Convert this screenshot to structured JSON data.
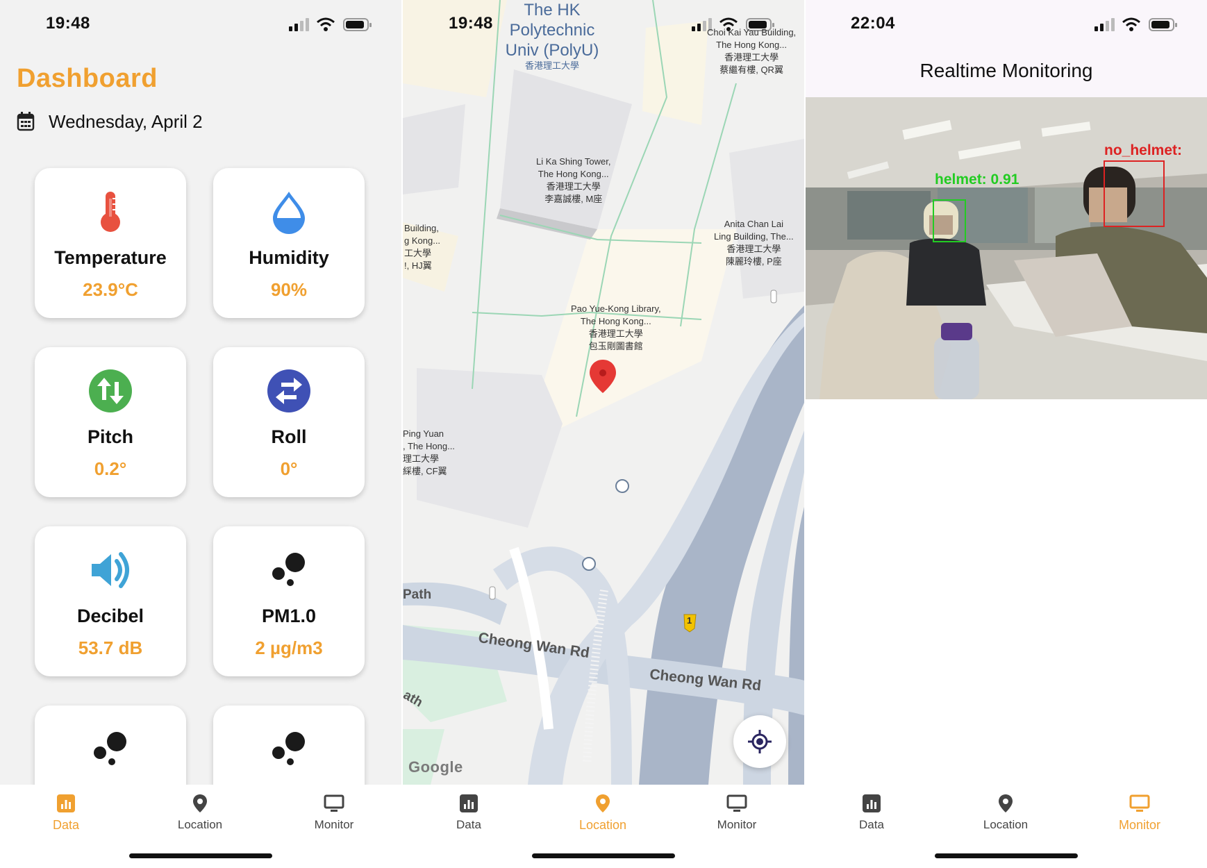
{
  "screens": {
    "data": {
      "time": "19:48",
      "title": "Dashboard",
      "date": "Wednesday, April 2",
      "cards": [
        {
          "label": "Temperature",
          "value": "23.9°C",
          "icon": "thermometer-icon"
        },
        {
          "label": "Humidity",
          "value": "90%",
          "icon": "water-drop-icon"
        },
        {
          "label": "Pitch",
          "value": "0.2°",
          "icon": "swap-vertical-icon"
        },
        {
          "label": "Roll",
          "value": "0°",
          "icon": "swap-horizontal-icon"
        },
        {
          "label": "Decibel",
          "value": "53.7 dB",
          "icon": "speaker-icon"
        },
        {
          "label": "PM1.0",
          "value": "2 µg/m3",
          "icon": "bubbles-icon"
        }
      ],
      "partial_card_icons": [
        "bubbles-icon",
        "bubbles-icon"
      ]
    },
    "location": {
      "time": "19:48",
      "map_title": "The HK Polytechnic Univ (PolyU)",
      "map_title_cn": "香港理工大學",
      "poi": {
        "choi_kai_yau": [
          "Choi Kai Yau Building,",
          "The Hong Kong...",
          "香港理工大學",
          "蔡繼有樓, QR翼"
        ],
        "li_ka_shing": [
          "Li Ka Shing Tower,",
          "The Hong Kong...",
          "香港理工大學",
          "李嘉誠樓, M座"
        ],
        "anita_chan": [
          "Anita Chan Lai",
          "Ling Building, The...",
          "香港理工大學",
          "陳麗玲樓, P座"
        ],
        "library": [
          "Pao Yue-Kong Library,",
          "The Hong Kong...",
          "香港理工大學",
          "包玉剛圖書館"
        ],
        "hj_building": [
          "Building,",
          "g Kong...",
          "工大學",
          "!, HJ翼"
        ],
        "ping_yuan": [
          "Ping Yuan",
          ", The Hong...",
          "理工大學",
          "綵樓, CF翼"
        ]
      },
      "roads": {
        "cheong_wan_1": "Cheong Wan Rd",
        "cheong_wan_2": "Cheong Wan Rd",
        "path_1": "Path",
        "path_2": "ath"
      },
      "route_badge": "1",
      "attribution": "Google"
    },
    "monitor": {
      "time": "22:04",
      "title": "Realtime Monitoring",
      "detections": [
        {
          "label": "helmet: 0.91",
          "color": "#22cc22"
        },
        {
          "label": "no_helmet:",
          "color": "#dd2222"
        }
      ]
    }
  },
  "nav": {
    "items": [
      {
        "label": "Data",
        "icon": "bar-chart-icon"
      },
      {
        "label": "Location",
        "icon": "location-pin-icon"
      },
      {
        "label": "Monitor",
        "icon": "monitor-icon"
      }
    ]
  },
  "colors": {
    "accent": "#f0a030",
    "temperature": "#e8513f",
    "humidity": "#3f8de8",
    "pitch": "#4caf50",
    "roll": "#3f51b5",
    "decibel": "#3fa3d6"
  }
}
